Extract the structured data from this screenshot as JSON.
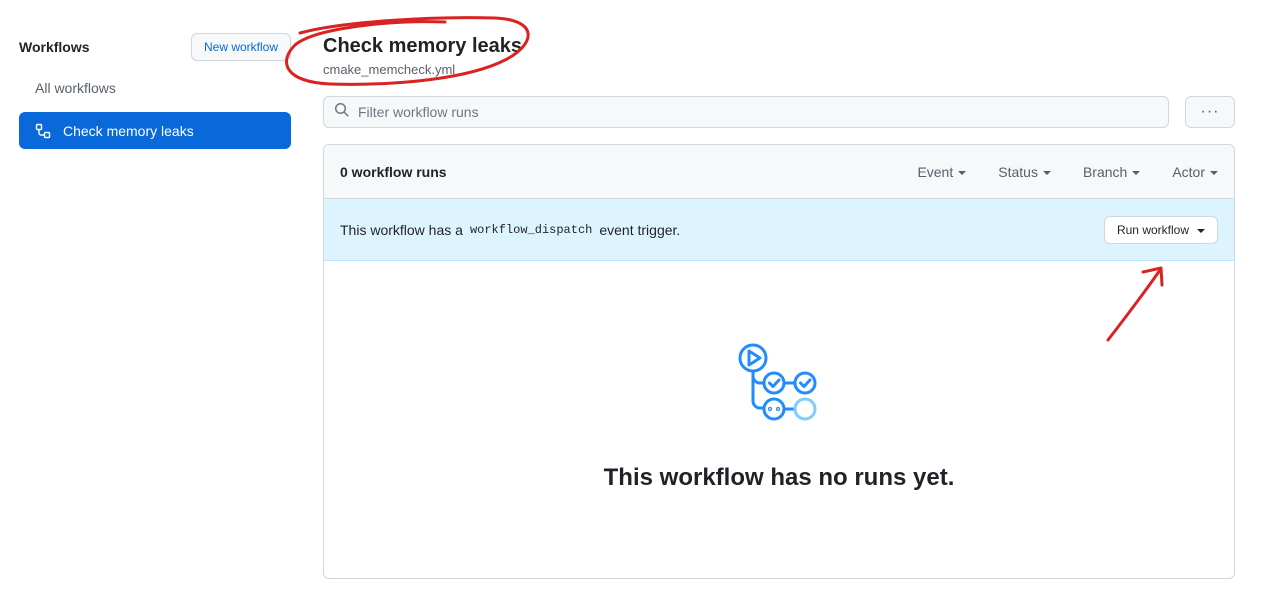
{
  "sidebar": {
    "title": "Workflows",
    "new_workflow_label": "New workflow",
    "items": [
      {
        "label": "All workflows",
        "active": false
      },
      {
        "label": "Check memory leaks",
        "active": true,
        "icon": "workflow-icon"
      }
    ]
  },
  "header": {
    "title": "Check memory leaks",
    "file": "cmake_memcheck.yml"
  },
  "search": {
    "placeholder": "Filter workflow runs",
    "value": "",
    "icon": "search-icon"
  },
  "more_menu_label": "···",
  "runs": {
    "count_label": "0 workflow runs",
    "filters": [
      "Event",
      "Status",
      "Branch",
      "Actor"
    ]
  },
  "dispatch": {
    "text_before": "This workflow has a",
    "code": "workflow_dispatch",
    "text_after": "event trigger.",
    "run_button_label": "Run workflow"
  },
  "blankslate": {
    "icon": "workflow-graph-icon",
    "message": "This workflow has no runs yet."
  },
  "colors": {
    "accent": "#0969da",
    "dispatch_bg": "#ddf4ff",
    "annotation": "#d92323"
  }
}
